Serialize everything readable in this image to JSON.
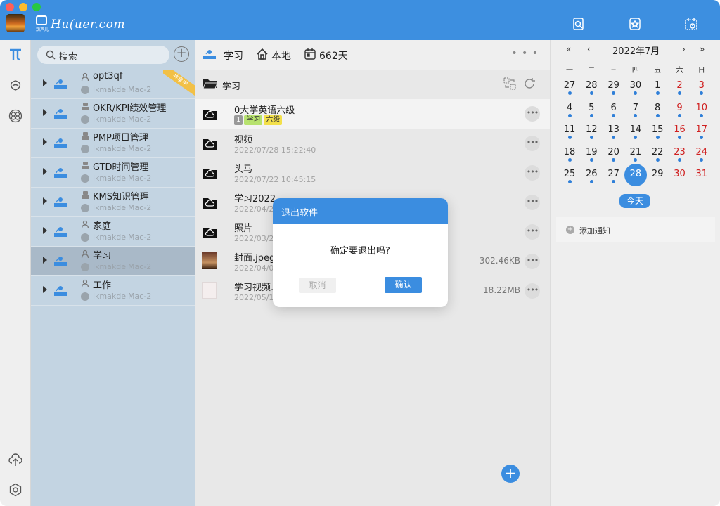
{
  "colors": {
    "accent": "#3b8de0",
    "weekend": "#d02020",
    "sidebar_bg": "#c3d4e2",
    "selected_bg": "#a9b9c8"
  },
  "titlebar": {
    "logo_text": "Hu(uer.com",
    "logo_sub": "葫芦儿",
    "icons": [
      "search-doc-icon",
      "badge-icon",
      "calendar-clock-icon"
    ]
  },
  "rail": {
    "icons": [
      "pi-logo-icon",
      "brain-icon",
      "rings-icon",
      "cloud-upload-icon",
      "settings-icon"
    ]
  },
  "search": {
    "placeholder": "搜索"
  },
  "projects": [
    {
      "name": "opt3qf",
      "host": "lkmakdeiMac-2",
      "type": "person",
      "ribbon": "共享中"
    },
    {
      "name": "OKR/KPI绩效管理",
      "host": "lkmakdeiMac-2",
      "type": "group"
    },
    {
      "name": "PMP项目管理",
      "host": "lkmakdeiMac-2",
      "type": "group"
    },
    {
      "name": "GTD时间管理",
      "host": "lkmakdeiMac-2",
      "type": "group"
    },
    {
      "name": "KMS知识管理",
      "host": "lkmakdeiMac-2",
      "type": "group"
    },
    {
      "name": "家庭",
      "host": "lkmakdeiMac-2",
      "type": "person"
    },
    {
      "name": "学习",
      "host": "lkmakdeiMac-2",
      "type": "person",
      "selected": true
    },
    {
      "name": "工作",
      "host": "lkmakdeiMac-2",
      "type": "person"
    }
  ],
  "files_header": {
    "project": "学习",
    "location": "本地",
    "days": "662天",
    "more": "• • •"
  },
  "path": {
    "current": "学习"
  },
  "files": [
    {
      "name": "0大学英语六级",
      "date": "",
      "size": "",
      "kind": "cloud-folder",
      "tags": [
        "1",
        "学习",
        "六级"
      ]
    },
    {
      "name": "视频",
      "date": "2022/07/28 15:22:40",
      "size": "",
      "kind": "cloud-folder"
    },
    {
      "name": "头马",
      "date": "2022/07/22 10:45:15",
      "size": "",
      "kind": "cloud-folder"
    },
    {
      "name": "学习2022",
      "date": "2022/04/2",
      "size": "",
      "kind": "cloud-folder"
    },
    {
      "name": "照片",
      "date": "2022/03/2",
      "size": "",
      "kind": "cloud-folder"
    },
    {
      "name": "封面.jpeg",
      "date": "2022/04/0",
      "size": "302.46KB",
      "kind": "image"
    },
    {
      "name": "学习视频.",
      "date": "2022/05/1",
      "size": "18.22MB",
      "kind": "doc"
    }
  ],
  "calendar": {
    "nav": {
      "prev_year": "«",
      "prev_month": "‹",
      "next_month": "›",
      "next_year": "»"
    },
    "title": "2022年7月",
    "weekdays": [
      "一",
      "二",
      "三",
      "四",
      "五",
      "六",
      "日"
    ],
    "weeks": [
      [
        "27",
        "28",
        "29",
        "30",
        "1",
        "2",
        "3"
      ],
      [
        "4",
        "5",
        "6",
        "7",
        "8",
        "9",
        "10"
      ],
      [
        "11",
        "12",
        "13",
        "14",
        "15",
        "16",
        "17"
      ],
      [
        "18",
        "19",
        "20",
        "21",
        "22",
        "23",
        "24"
      ],
      [
        "25",
        "26",
        "27",
        "28",
        "29",
        "30",
        "31"
      ]
    ],
    "today": "28",
    "today_label": "今天",
    "add_notify": "添加通知"
  },
  "modal": {
    "title": "退出软件",
    "message": "确定要退出吗?",
    "cancel": "取消",
    "ok": "确认"
  }
}
